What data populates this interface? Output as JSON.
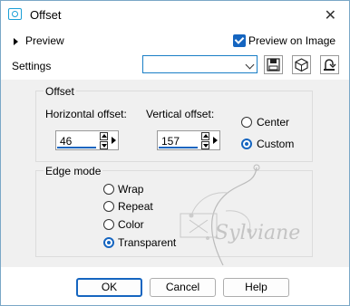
{
  "window": {
    "title": "Offset",
    "close_glyph": "✕"
  },
  "preview": {
    "label": "Preview",
    "preview_on_image_label": "Preview on Image",
    "preview_on_image_checked": true
  },
  "settings": {
    "label": "Settings",
    "preset_value": ""
  },
  "offset_group": {
    "title": "Offset",
    "horizontal_label": "Horizontal offset:",
    "horizontal_value": "46",
    "vertical_label": "Vertical offset:",
    "vertical_value": "157",
    "options": [
      {
        "label": "Center",
        "selected": false
      },
      {
        "label": "Custom",
        "selected": true
      }
    ]
  },
  "edge_mode": {
    "title": "Edge mode",
    "options": [
      {
        "label": "Wrap",
        "selected": false
      },
      {
        "label": "Repeat",
        "selected": false
      },
      {
        "label": "Color",
        "selected": false
      },
      {
        "label": "Transparent",
        "selected": true
      }
    ]
  },
  "watermark": {
    "text": "Sylviane"
  },
  "buttons": {
    "ok": "OK",
    "cancel": "Cancel",
    "help": "Help"
  },
  "colors": {
    "accent": "#1565c0",
    "window_border": "#7aa7c7"
  },
  "icons": [
    "app-offset-icon",
    "close-icon",
    "expand-triangle-icon",
    "dropdown-arrow-icon",
    "save-preset-icon",
    "preset-options-icon",
    "reset-icon"
  ]
}
